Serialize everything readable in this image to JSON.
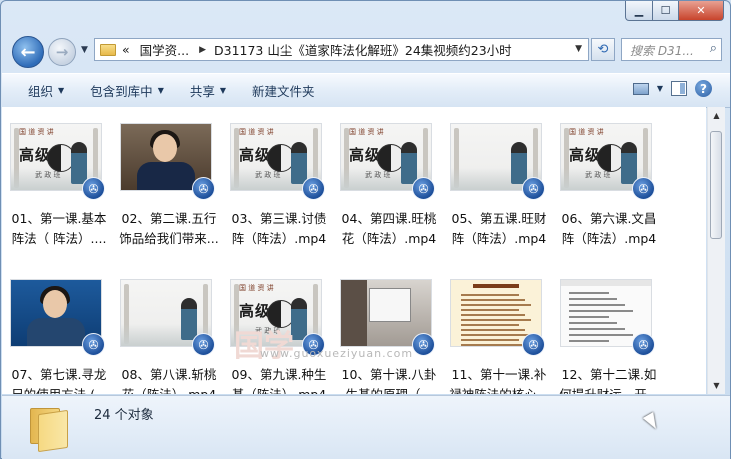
{
  "window": {
    "caption": {
      "minimize": "▁",
      "maximize": "☐",
      "close": "✕"
    }
  },
  "nav": {
    "back_icon": "←",
    "forward_icon": "→",
    "breadcrumb": [
      "«",
      "国学资...",
      "D31173 山尘《道家阵法化解班》24集视频约23小时"
    ],
    "search_placeholder": "搜索 D31...",
    "refresh_icon": "⟲"
  },
  "toolbar": {
    "organize": "组织",
    "include_library": "包含到库中",
    "share": "共享",
    "new_folder": "新建文件夹"
  },
  "files": [
    {
      "line1": "01、第一课.基本",
      "line2": "阵法（ 阵法）....",
      "thumb": "scroll"
    },
    {
      "line1": "02、第二课.五行",
      "line2": "饰品给我们带来...",
      "thumb": "face"
    },
    {
      "line1": "03、第三课.讨债",
      "line2": "阵（阵法）.mp4",
      "thumb": "scroll"
    },
    {
      "line1": "04、第四课.旺桃",
      "line2": "花（阵法）.mp4",
      "thumb": "scroll"
    },
    {
      "line1": "05、第五课.旺财",
      "line2": "阵（阵法）.mp4",
      "thumb": "scroll-plain"
    },
    {
      "line1": "06、第六课.文昌",
      "line2": "阵（阵法）.mp4",
      "thumb": "scroll"
    },
    {
      "line1": "07、第七课.寻龙",
      "line2": "尺的使用方法 (...",
      "thumb": "face-blue"
    },
    {
      "line1": "08、第八课.斩桃",
      "line2": "花（阵法）.mp4",
      "thumb": "scroll-plain"
    },
    {
      "line1": "09、第九课.种生",
      "line2": "基（阵法）.mp4",
      "thumb": "scroll"
    },
    {
      "line1": "10、第十课.八卦",
      "line2": "生基的原理（...",
      "thumb": "room"
    },
    {
      "line1": "11、第十一课.补",
      "line2": "禄神阵法的核心...",
      "thumb": "doc"
    },
    {
      "line1": "12、第十二课.如",
      "line2": "何提升财运、开...",
      "thumb": "list"
    }
  ],
  "thumb_text": {
    "big": "高级",
    "sub": "武 政 班",
    "top_label": "国 道 资 讲"
  },
  "watermark": {
    "logo": "国学",
    "url": "www.guoxueziyuan.com"
  },
  "status": {
    "count": "24 个对象"
  }
}
